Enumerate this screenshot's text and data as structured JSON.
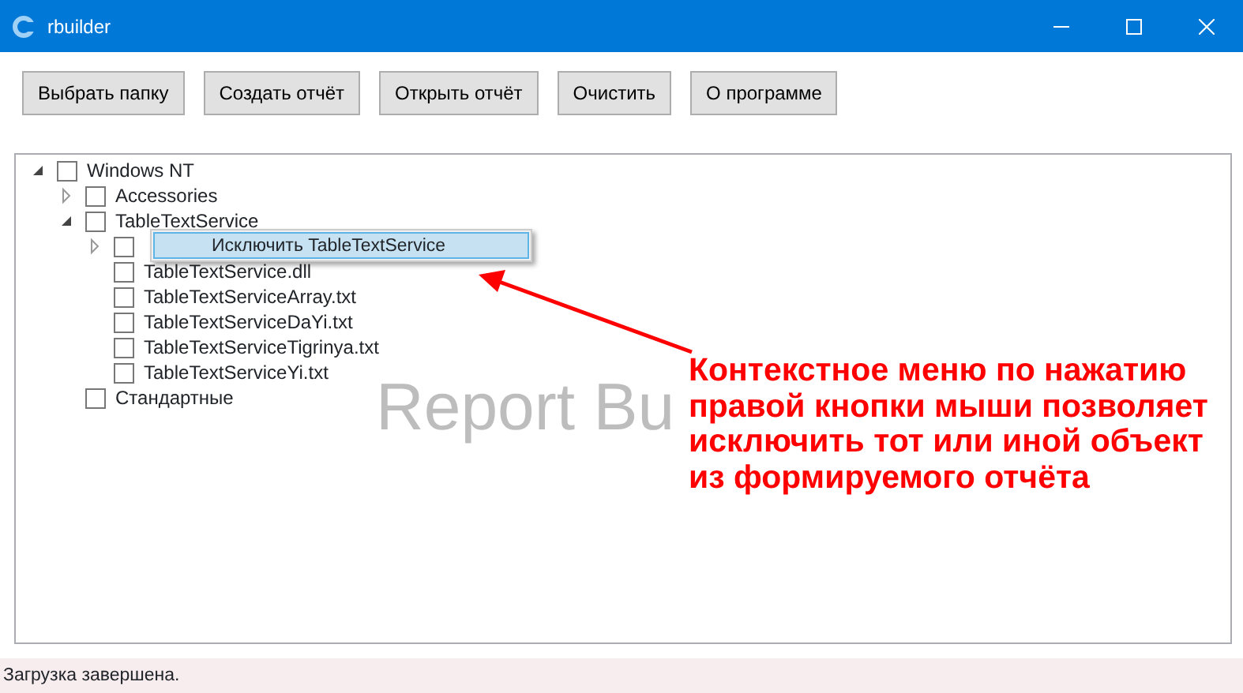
{
  "window": {
    "title": "rbuilder"
  },
  "toolbar": [
    "Выбрать папку",
    "Создать отчёт",
    "Открыть отчёт",
    "Очистить",
    "О программе"
  ],
  "tree": [
    {
      "label": "Windows NT",
      "checked": false,
      "expanded": true,
      "children": [
        {
          "label": "Accessories",
          "checked": false,
          "expanded": false
        },
        {
          "label": "TableTextService",
          "checked": false,
          "expanded": true,
          "children": [
            {
              "checked": false,
              "expanded": false
            },
            {
              "label": "TableTextService.dll",
              "checked": false
            },
            {
              "label": "TableTextServiceArray.txt",
              "checked": false
            },
            {
              "label": "TableTextServiceDaYi.txt",
              "checked": false
            },
            {
              "label": "TableTextServiceTigrinya.txt",
              "checked": false
            },
            {
              "label": "TableTextServiceYi.txt",
              "checked": false
            }
          ]
        },
        {
          "label": "Стандартные",
          "checked": false
        }
      ]
    }
  ],
  "watermark": "Report Bu",
  "context_menu": {
    "items": [
      {
        "label": "Исключить TableTextService",
        "selected": true
      }
    ]
  },
  "annotation": "Контекстное меню по нажатию правой кнопки мыши позволяет исключить тот или иной объект из формируемого отчёта",
  "status_bar": "Загрузка завершена."
}
